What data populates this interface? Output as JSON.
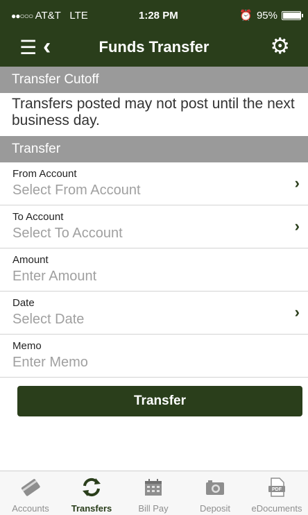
{
  "status_bar": {
    "carrier": "AT&T",
    "network": "LTE",
    "time": "1:28 PM",
    "battery": "95%",
    "battery_level": 0.95,
    "signal_dots": "●●○○○"
  },
  "nav": {
    "title": "Funds Transfer",
    "menu_icon": "menu-icon",
    "back_icon": "back-chevron-icon",
    "settings_icon": "gear-icon"
  },
  "cutoff": {
    "header": "Transfer Cutoff",
    "message": "Transfers posted may not post until the next business day."
  },
  "transfer": {
    "header": "Transfer",
    "fields": [
      {
        "label": "From Account",
        "placeholder": "Select From Account",
        "chevron": "›"
      },
      {
        "label": "To Account",
        "placeholder": "Select To Account",
        "chevron": "›"
      },
      {
        "label": "Amount",
        "placeholder": "Enter Amount"
      },
      {
        "label": "Date",
        "placeholder": "Select Date",
        "chevron": "›"
      },
      {
        "label": "Memo",
        "placeholder": "Enter Memo"
      }
    ],
    "button_label": "Transfer"
  },
  "tabs": [
    {
      "label": "Accounts",
      "icon": "card-icon"
    },
    {
      "label": "Transfers",
      "icon": "refresh-icon",
      "active": true
    },
    {
      "label": "Bill Pay",
      "icon": "calendar-icon"
    },
    {
      "label": "Deposit",
      "icon": "camera-icon"
    },
    {
      "label": "eDocuments",
      "icon": "pdf-icon"
    }
  ],
  "colors": {
    "brand": "#2a3e1b",
    "section_bg": "#9a9a9a",
    "placeholder": "#a0a0a0"
  }
}
